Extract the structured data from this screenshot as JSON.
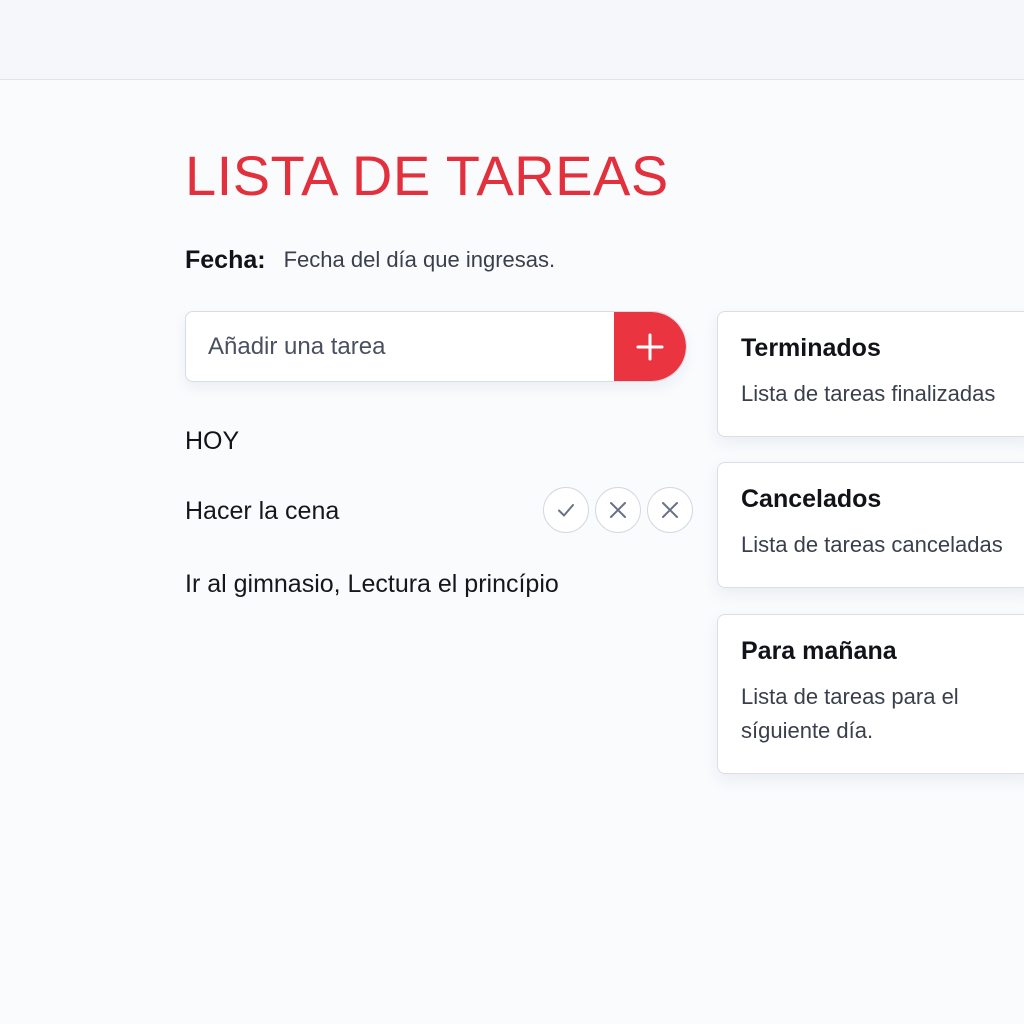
{
  "header": {
    "title": "LISTA DE TAREAS"
  },
  "date": {
    "label": "Fecha:",
    "value": "Fecha del día que ingresas."
  },
  "add_task": {
    "placeholder": "Añadir una tarea",
    "button_icon": "plus-icon"
  },
  "today": {
    "heading": "HOY",
    "tasks": [
      {
        "text": "Hacer la cena",
        "actions": [
          "check-icon",
          "close-icon",
          "close-icon"
        ]
      },
      {
        "text": "Ir al gimnasio, Lectura el princípio"
      }
    ]
  },
  "cards": [
    {
      "title": "Terminados",
      "description": "Lista de tareas  finalizadas"
    },
    {
      "title": "Cancelados",
      "description": "Lista de tareas canceladas"
    },
    {
      "title": "Para mañana",
      "description": "Lista de tareas para el síguiente día."
    }
  ],
  "colors": {
    "accent": "#e2303d",
    "button": "#ea3541",
    "background": "#f9fbfd"
  }
}
